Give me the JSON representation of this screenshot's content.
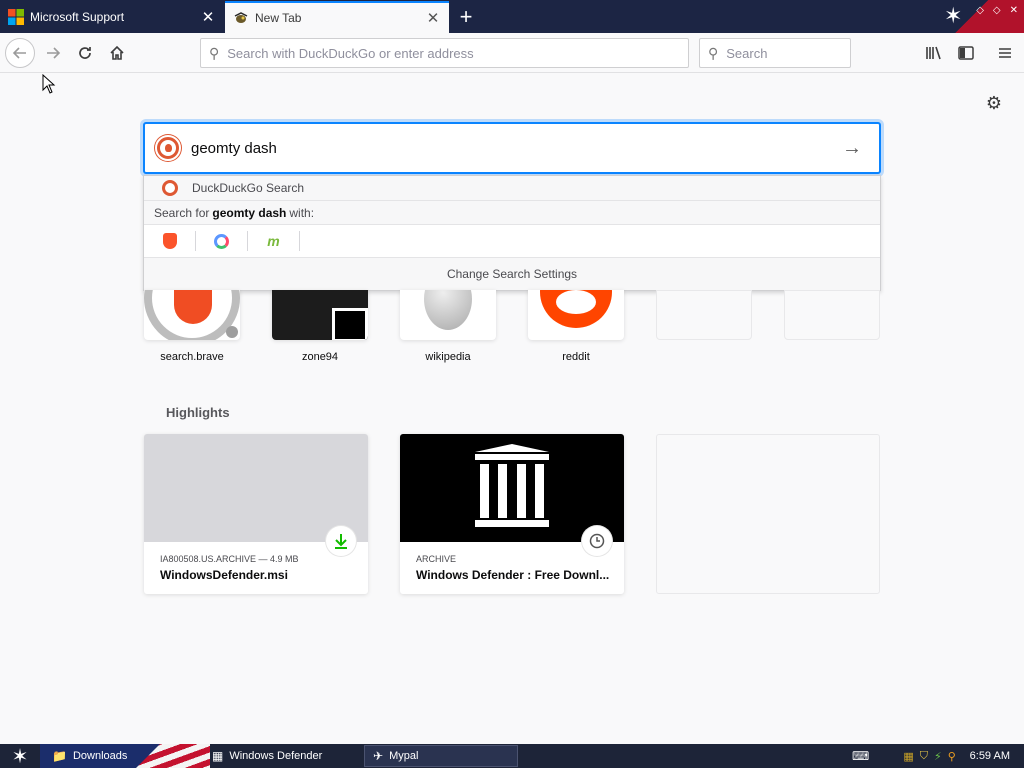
{
  "tabs": [
    {
      "label": "Microsoft Support",
      "icon": "microsoft-logo-icon",
      "active": false
    },
    {
      "label": "New Tab",
      "icon": "mypal-logo-icon",
      "active": true
    }
  ],
  "toolbar": {
    "url_placeholder": "Search with DuckDuckGo or enter address",
    "search_placeholder": "Search"
  },
  "search": {
    "query": "geomty dash",
    "engine_label": "DuckDuckGo Search",
    "search_for_prefix": "Search for",
    "search_for_term": "geomty dash",
    "search_for_suffix": "with:",
    "engines": [
      "brave-icon",
      "qwant-icon",
      "mojeek-icon"
    ],
    "settings_label": "Change Search Settings"
  },
  "topsites": [
    {
      "label": "search.brave"
    },
    {
      "label": "zone94"
    },
    {
      "label": "wikipedia"
    },
    {
      "label": "reddit"
    },
    {
      "label": ""
    },
    {
      "label": ""
    }
  ],
  "highlights": {
    "title": "Highlights",
    "cards": [
      {
        "meta": "IA800508.US.ARCHIVE — 4.9 MB",
        "title": "WindowsDefender.msi",
        "badge": "download-icon"
      },
      {
        "meta": "ARCHIVE",
        "title": "Windows Defender : Free Downl...",
        "badge": "clock-icon"
      }
    ]
  },
  "taskbar": {
    "items": [
      {
        "label": "Downloads"
      },
      {
        "label": "Windows Defender"
      },
      {
        "label": "Mypal"
      }
    ],
    "clock": "6:59 AM"
  },
  "colors": {
    "accent": "#0a84ff",
    "titlebar": "#1c2544",
    "ddg_orange": "#de5833",
    "download_green": "#12bc00"
  }
}
